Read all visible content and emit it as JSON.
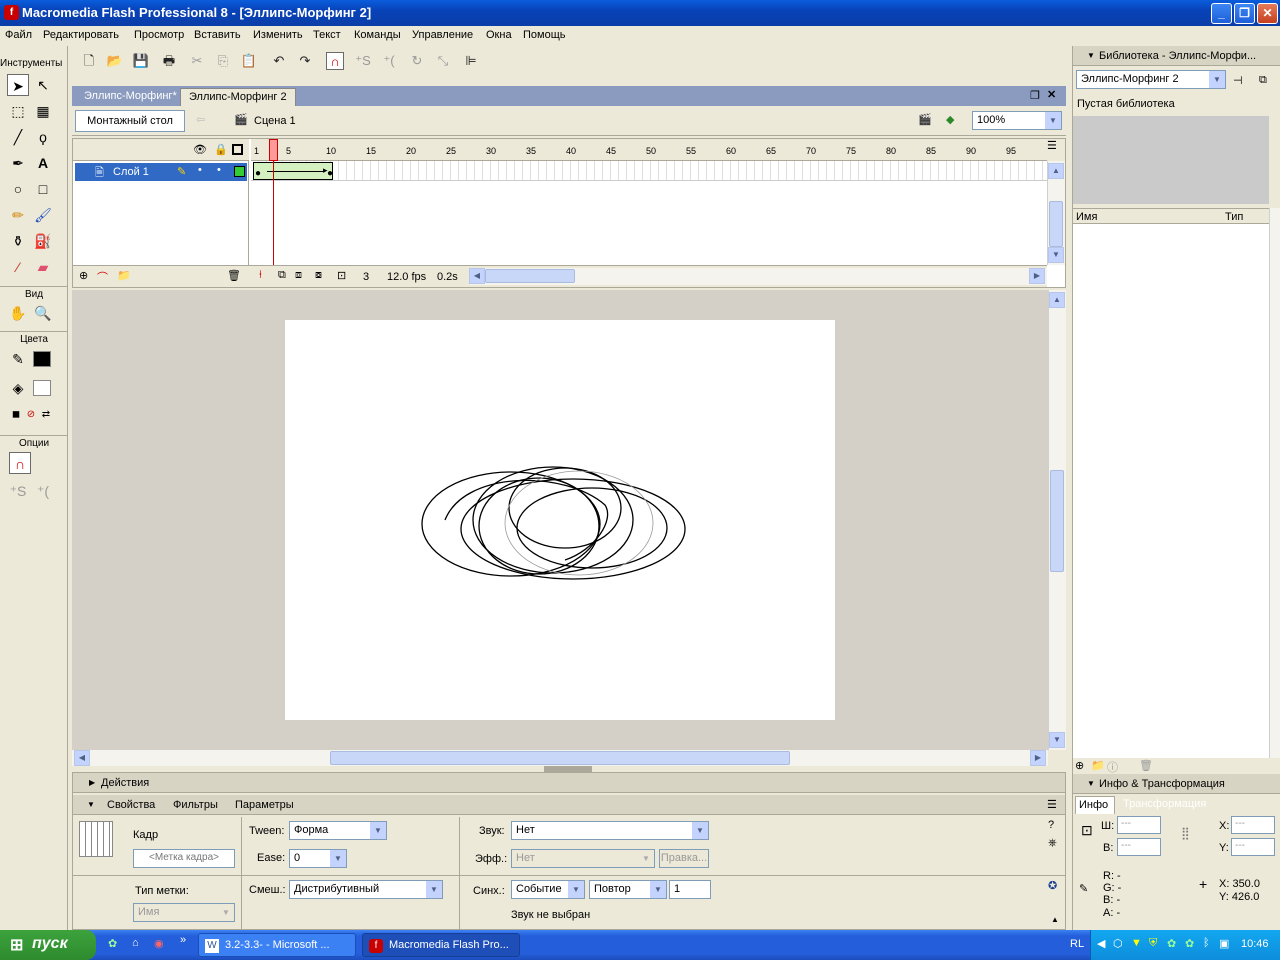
{
  "window": {
    "title": "Macromedia Flash Professional 8 - [Эллипс-Морфинг 2]",
    "controls": [
      "_",
      "❐",
      "✕"
    ]
  },
  "menu": [
    "Файл",
    "Редактировать",
    "Просмотр",
    "Вставить",
    "Изменить",
    "Текст",
    "Команды",
    "Управление",
    "Окна",
    "Помощь"
  ],
  "tools": {
    "title": "Инструменты",
    "view_label": "Вид",
    "colors_label": "Цвета",
    "options_label": "Опции"
  },
  "doc_tabs": [
    "Эллипс-Морфинг*",
    "Эллипс-Морфинг 2"
  ],
  "editbar": {
    "timeline_button": "Монтажный стол",
    "scene": "Сцена 1",
    "zoom": "100%"
  },
  "timeline": {
    "layer_name": "Слой 1",
    "ruler_ticks": [
      "1",
      "5",
      "10",
      "15",
      "20",
      "25",
      "30",
      "35",
      "40",
      "45",
      "50",
      "55",
      "60",
      "65",
      "70",
      "75",
      "80",
      "85",
      "90",
      "95"
    ],
    "current_frame": "3",
    "fps": "12.0 fps",
    "time": "0.2s"
  },
  "panels": {
    "actions": "Действия",
    "tabs": [
      "Свойства",
      "Фильтры",
      "Параметры"
    ]
  },
  "properties": {
    "frame_label": "Кадр",
    "frame_name_placeholder": "<Метка кадра>",
    "label_type": "Тип метки:",
    "label_type_value": "Имя",
    "tween_label": "Tween:",
    "tween_value": "Форма",
    "ease_label": "Ease:",
    "ease_value": "0",
    "blend_label": "Смеш.:",
    "blend_value": "Дистрибутивный",
    "sound_label": "Звук:",
    "sound_value": "Нет",
    "effect_label": "Эфф.:",
    "effect_value": "Нет",
    "edit_button": "Правка...",
    "sync_label": "Синх.:",
    "sync_value": "Событие",
    "repeat_value": "Повтор",
    "repeat_count": "1",
    "sound_status": "Звук не выбран"
  },
  "library": {
    "title": "Библиотека - Эллипс-Морфи...",
    "doc_select": "Эллипс-Морфинг 2",
    "empty": "Пустая библиотека",
    "col_name": "Имя",
    "col_type": "Тип"
  },
  "info": {
    "title": "Инфо & Трансформация",
    "tabs": [
      "Инфо",
      "Трансформация"
    ],
    "w_label": "Ш:",
    "h_label": "В:",
    "x_label": "X:",
    "y_label": "Y:",
    "w_value": "---",
    "h_value": "---",
    "x_value": "---",
    "y_value": "---",
    "r": "R: -",
    "g": "G: -",
    "b": "B: -",
    "a": "A: -",
    "cursor_x": "X:  350.0",
    "cursor_y": "Y:  426.0"
  },
  "taskbar": {
    "start": "пуск",
    "tasks": [
      "3.2-3.3- - Microsoft ...",
      "Macromedia Flash Pro..."
    ],
    "lang": "RL",
    "clock": "10:46"
  }
}
